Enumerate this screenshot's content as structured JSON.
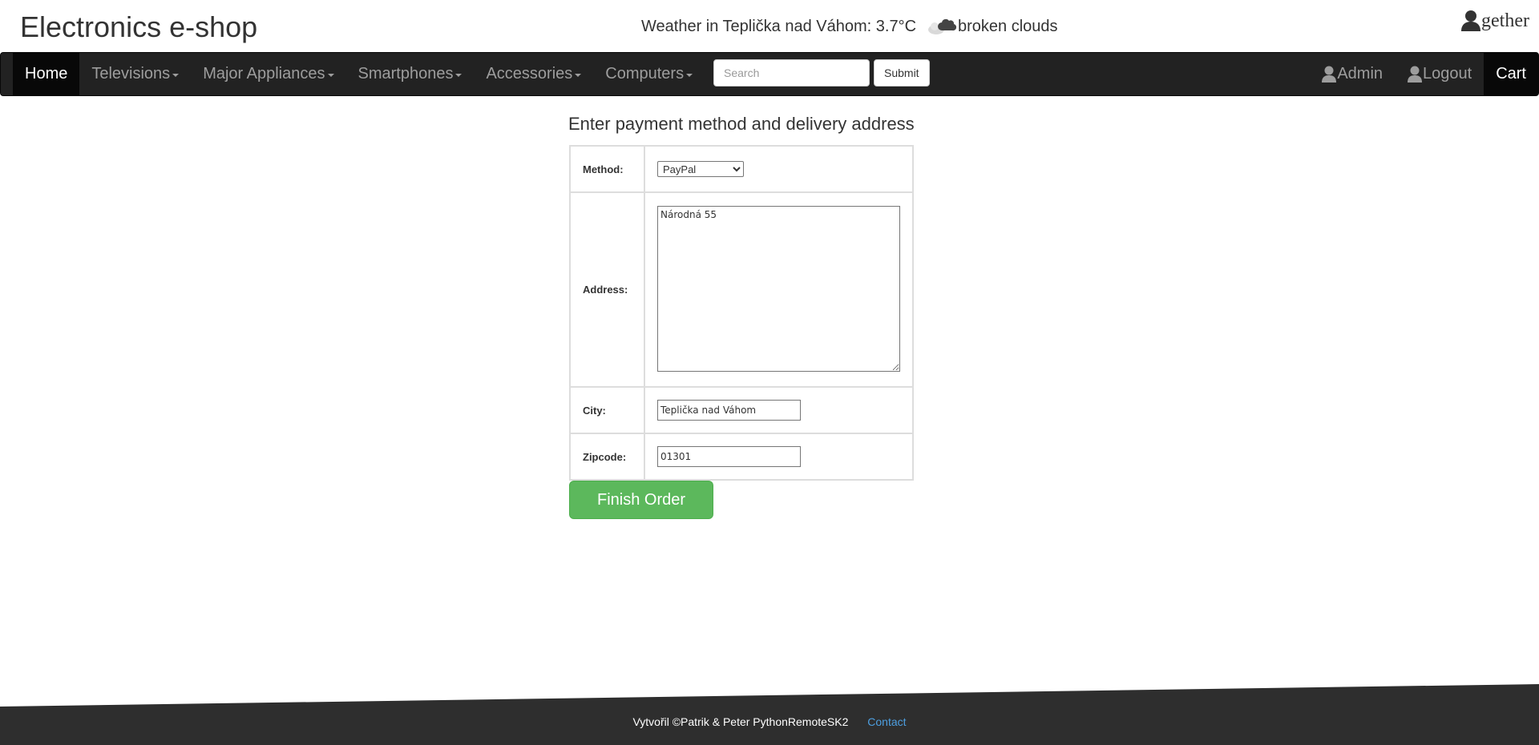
{
  "header": {
    "site_title": "Electronics e-shop",
    "weather_text": "Weather in Teplička nad Váhom: 3.7°C",
    "weather_desc": "broken clouds",
    "weather_icon": "broken-clouds-icon",
    "username": "gether"
  },
  "nav": {
    "items": [
      {
        "label": "Home",
        "active": true,
        "dropdown": false
      },
      {
        "label": "Televisions",
        "active": false,
        "dropdown": true
      },
      {
        "label": "Major Appliances",
        "active": false,
        "dropdown": true
      },
      {
        "label": "Smartphones",
        "active": false,
        "dropdown": true
      },
      {
        "label": "Accessories",
        "active": false,
        "dropdown": true
      },
      {
        "label": "Computers",
        "active": false,
        "dropdown": true
      }
    ],
    "search_placeholder": "Search",
    "search_value": "",
    "submit_label": "Submit",
    "admin_label": "Admin",
    "logout_label": "Logout",
    "cart_label": "Cart"
  },
  "form": {
    "title": "Enter payment method and delivery address",
    "method_label": "Method:",
    "method_value": "PayPal",
    "address_label": "Address:",
    "address_value": "Národná 55",
    "city_label": "City:",
    "city_value": "Teplička nad Váhom",
    "zip_label": "Zipcode:",
    "zip_value": "01301",
    "finish_label": "Finish Order"
  },
  "footer": {
    "credit": "Vytvořil ©Patrik & Peter PythonRemoteSK2",
    "contact_label": "Contact"
  },
  "colors": {
    "navbar_bg": "#222222",
    "nav_active_bg": "#080808",
    "finish_btn": "#5cb85c",
    "footer_bg": "#2e2e2e",
    "contact_link": "#4d9fe0"
  }
}
